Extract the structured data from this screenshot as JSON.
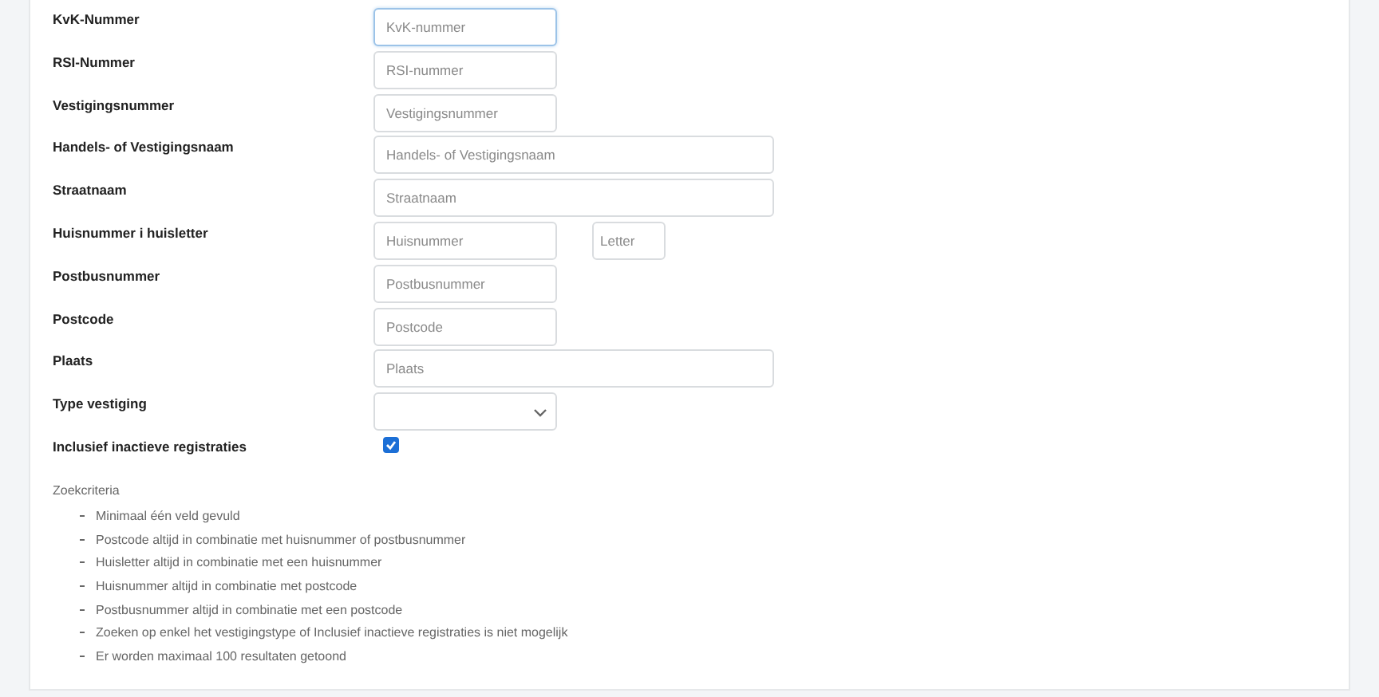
{
  "form": {
    "rows": [
      {
        "label": "KvK-Nummer",
        "kind": "short",
        "inputs": [
          {
            "placeholder": "KvK-nummer",
            "focused": true
          }
        ]
      },
      {
        "label": "RSI-Nummer",
        "kind": "short",
        "inputs": [
          {
            "placeholder": "RSI-nummer",
            "focused": false
          }
        ]
      },
      {
        "label": "Vestigingsnummer",
        "kind": "short",
        "inputs": [
          {
            "placeholder": "Vestigingsnummer",
            "focused": false
          }
        ]
      },
      {
        "label": "Handels- of Vestigingsnaam",
        "kind": "wide",
        "inputs": [
          {
            "placeholder": "Handels- of Vestigingsnaam",
            "focused": false
          }
        ]
      },
      {
        "label": "Straatnaam",
        "kind": "wide",
        "inputs": [
          {
            "placeholder": "Straatnaam",
            "focused": false
          }
        ]
      },
      {
        "label": "Huisnummer i huisletter",
        "kind": "pair",
        "inputs": [
          {
            "placeholder": "Huisnummer",
            "focused": false
          },
          {
            "placeholder": "Letter",
            "focused": false
          }
        ]
      },
      {
        "label": "Postbusnummer",
        "kind": "short",
        "inputs": [
          {
            "placeholder": "Postbusnummer",
            "focused": false
          }
        ]
      },
      {
        "label": "Postcode",
        "kind": "short",
        "inputs": [
          {
            "placeholder": "Postcode",
            "focused": false
          }
        ]
      },
      {
        "label": "Plaats",
        "kind": "wide",
        "inputs": [
          {
            "placeholder": "Plaats",
            "focused": false
          }
        ]
      },
      {
        "label": "Type vestiging",
        "kind": "select"
      },
      {
        "label": "Inclusief inactieve registraties",
        "kind": "checkbox",
        "checked": true
      }
    ]
  },
  "criteria": {
    "title": "Zoekcriteria",
    "items": [
      "Minimaal één veld gevuld",
      "Postcode altijd in combinatie met huisnummer of postbusnummer",
      "Huisletter altijd in combinatie met een huisnummer",
      "Huisnummer altijd in combinatie met postcode",
      "Postbusnummer altijd in combinatie met een postcode",
      "Zoeken op enkel het vestigingstype of Inclusief inactieve registraties is niet mogelijk",
      "Er worden maximaal 100 resultaten getoond"
    ]
  }
}
